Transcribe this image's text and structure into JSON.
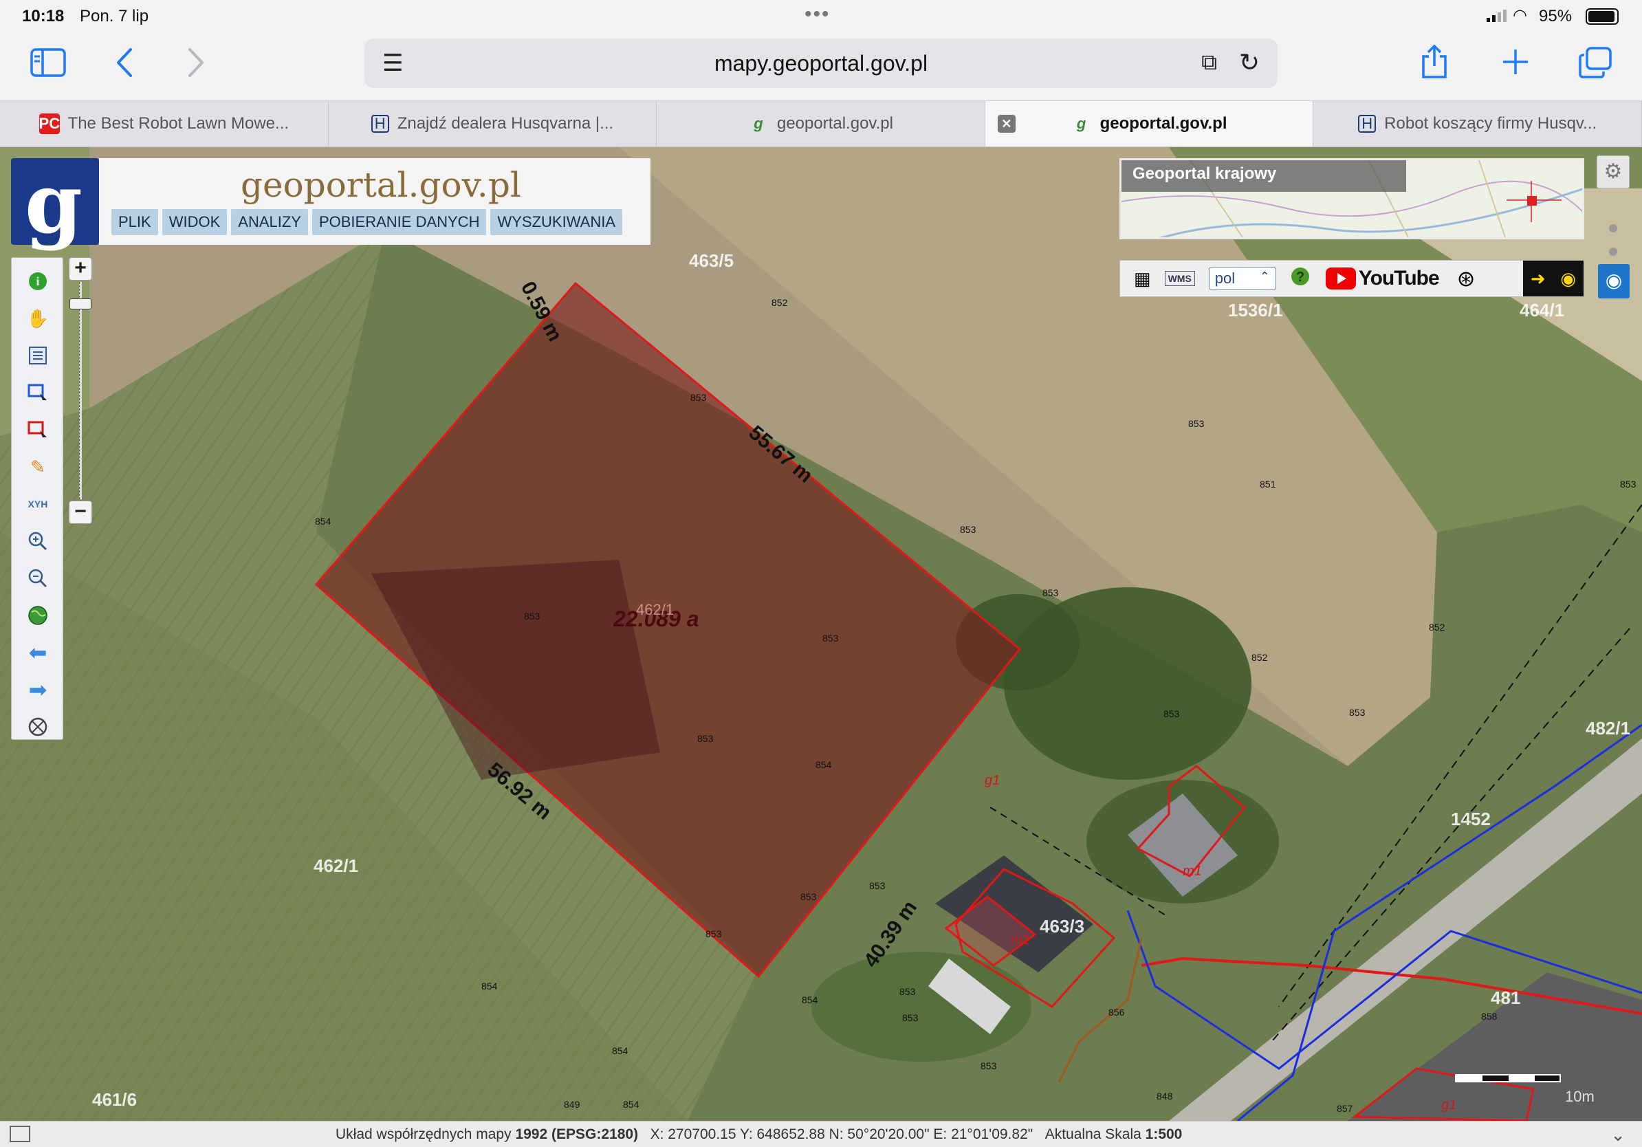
{
  "status_bar": {
    "time": "10:18",
    "date": "Pon. 7 lip",
    "battery": "95%"
  },
  "toolbar": {
    "url": "mapy.geoportal.gov.pl",
    "sidebar_icon": "sidebar-icon",
    "back_icon": "chevron-left-icon",
    "forward_icon": "chevron-right-icon",
    "share_icon": "share-icon",
    "new_tab_icon": "plus-icon",
    "tabs_icon": "tabs-overview-icon"
  },
  "tabs": [
    {
      "title": "The Best Robot Lawn Mowe...",
      "favicon": "PC"
    },
    {
      "title": "Znajdź dealera Husqvarna |...",
      "favicon": "H"
    },
    {
      "title": "geoportal.gov.pl",
      "favicon": "g"
    },
    {
      "title": "geoportal.gov.pl",
      "favicon": "g",
      "active": true
    },
    {
      "title": "Robot koszący firmy Husqv...",
      "favicon": "H"
    }
  ],
  "geoportal": {
    "brand": "geoportal.gov.pl",
    "menu": [
      "PLIK",
      "WIDOK",
      "ANALIZY",
      "POBIERANIE DANYCH",
      "WYSZUKIWANIA"
    ],
    "overview_label": "Geoportal krajowy",
    "language": "pol",
    "youtube_label": "YouTube",
    "xyh_label": "XYH"
  },
  "map": {
    "parcel_area": "22.089 a",
    "parcel_id": "462/1",
    "edges": [
      "0.59 m",
      "55.67 m",
      "56.92 m",
      "40.39 m"
    ],
    "parcel_labels": [
      "463/5",
      "1536/1",
      "464/1",
      "462/1",
      "461/6",
      "463/3",
      "482/1",
      "1452",
      "481"
    ],
    "building_labels": [
      "g1",
      "m1",
      "m1",
      "g1"
    ],
    "heights": [
      "852",
      "853",
      "853",
      "853",
      "854",
      "853",
      "853",
      "853",
      "854",
      "853",
      "853",
      "851",
      "853",
      "853",
      "852",
      "852",
      "853",
      "853",
      "854",
      "853",
      "854",
      "853",
      "853",
      "854",
      "849",
      "854",
      "853",
      "856",
      "858",
      "857",
      "848"
    ],
    "scale_label": "10m"
  },
  "coord_bar": {
    "prefix": "Układ współrzędnych mapy",
    "system": "1992 (EPSG:2180)",
    "coords": "X: 270700.15 Y: 648652.88   N: 50°20'20.00\" E: 21°01'09.82\"",
    "scale_prefix": "Aktualna Skala",
    "scale": "1:500"
  }
}
